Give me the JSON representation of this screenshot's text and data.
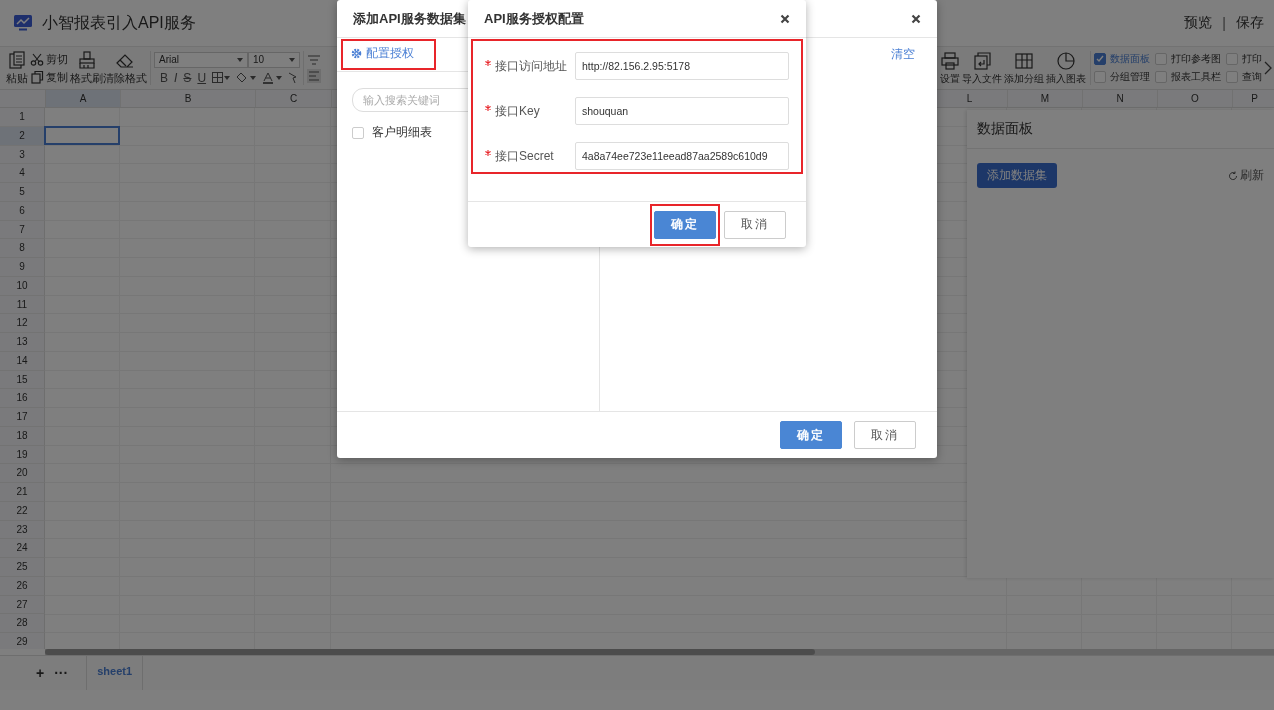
{
  "app": {
    "title": "小智报表引入API服务",
    "actions": [
      "预览",
      "保存"
    ],
    "separator": "|"
  },
  "toolbar": {
    "edit_tools": [
      {
        "label": "粘贴"
      },
      {
        "label": "剪切"
      },
      {
        "label": "复制"
      },
      {
        "label": "格式刷"
      },
      {
        "label": "清除格式"
      }
    ],
    "font": {
      "family": "Arial",
      "size": "10"
    },
    "format_buttons": [
      "B",
      "I",
      "S",
      "U"
    ],
    "right_tools": [
      {
        "label": "设置"
      },
      {
        "label": "导入文件"
      },
      {
        "label": "添加分组"
      },
      {
        "label": "插入图表"
      }
    ],
    "view_options": [
      {
        "label": "数据面板",
        "checked": true
      },
      {
        "label": "分组管理",
        "checked": false
      },
      {
        "label": "打印参考图",
        "checked": false
      },
      {
        "label": "报表工具栏",
        "checked": false
      },
      {
        "label": "打印",
        "checked": false
      },
      {
        "label": "查询",
        "checked": false
      }
    ]
  },
  "sheet": {
    "columns": [
      {
        "label": "A",
        "selected": true
      },
      {
        "label": "B",
        "selected": false
      },
      {
        "label": "C",
        "selected": false
      },
      {
        "label": "L",
        "selected": false
      },
      {
        "label": "M",
        "selected": false
      },
      {
        "label": "N",
        "selected": false
      },
      {
        "label": "O",
        "selected": false
      },
      {
        "label": "P",
        "selected": false
      }
    ],
    "rows": [
      {
        "label": "1",
        "selected": false
      },
      {
        "label": "2",
        "selected": true
      },
      {
        "label": "3",
        "selected": false
      },
      {
        "label": "4",
        "selected": false
      },
      {
        "label": "5",
        "selected": false
      },
      {
        "label": "6",
        "selected": false
      },
      {
        "label": "7",
        "selected": false
      },
      {
        "label": "8",
        "selected": false
      },
      {
        "label": "9",
        "selected": false
      },
      {
        "label": "10",
        "selected": false
      },
      {
        "label": "11",
        "selected": false
      },
      {
        "label": "12",
        "selected": false
      },
      {
        "label": "13",
        "selected": false
      },
      {
        "label": "14",
        "selected": false
      },
      {
        "label": "15",
        "selected": false
      },
      {
        "label": "16",
        "selected": false
      },
      {
        "label": "17",
        "selected": false
      },
      {
        "label": "18",
        "selected": false
      },
      {
        "label": "19",
        "selected": false
      },
      {
        "label": "20",
        "selected": false
      },
      {
        "label": "21",
        "selected": false
      },
      {
        "label": "22",
        "selected": false
      },
      {
        "label": "23",
        "selected": false
      },
      {
        "label": "24",
        "selected": false
      },
      {
        "label": "25",
        "selected": false
      },
      {
        "label": "26",
        "selected": false
      },
      {
        "label": "27",
        "selected": false
      },
      {
        "label": "28",
        "selected": false
      },
      {
        "label": "29",
        "selected": false
      }
    ],
    "tab_actions": [
      "+",
      "···"
    ],
    "tabs": [
      {
        "label": "sheet1",
        "selected": true
      }
    ]
  },
  "data_panel": {
    "title": "数据面板",
    "add_button": "添加数据集",
    "refresh": "刷新"
  },
  "dataset_dialog": {
    "title": "添加API服务数据集",
    "auth_link": {
      "label": "配置授权",
      "highlighted": true
    },
    "search_placeholder": "输入搜索关键词",
    "datasets": [
      {
        "label": "客户明细表",
        "checked": false
      }
    ],
    "clear_link": "清空",
    "buttons": [
      {
        "label": "确定",
        "kind": "primary",
        "highlighted": false
      },
      {
        "label": "取消",
        "kind": "default",
        "highlighted": false
      }
    ]
  },
  "auth_dialog": {
    "title": "API服务授权配置",
    "fields_highlighted": true,
    "fields": [
      {
        "label": "接口访问地址",
        "required": true,
        "value": "http://82.156.2.95:5178"
      },
      {
        "label": "接口Key",
        "required": true,
        "value": "shouquan"
      },
      {
        "label": "接口Secret",
        "required": true,
        "value": "4a8a74ee723e11eead87aa2589c610d9"
      }
    ],
    "buttons": [
      {
        "label": "确定",
        "kind": "primary",
        "highlighted": true
      },
      {
        "label": "取消",
        "kind": "default",
        "highlighted": false
      }
    ]
  }
}
